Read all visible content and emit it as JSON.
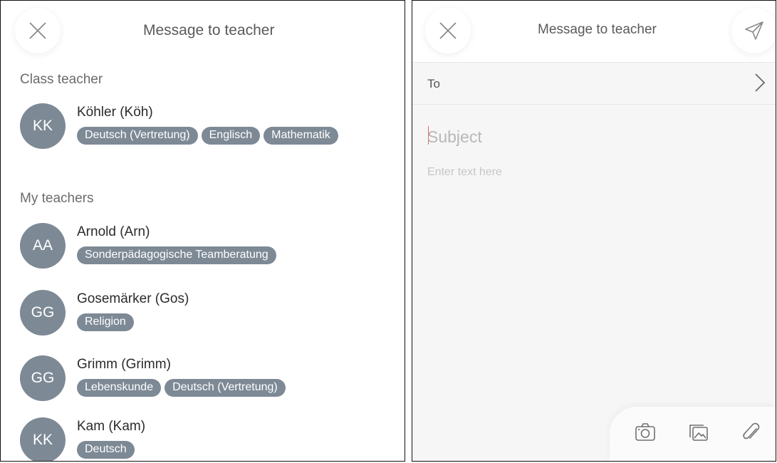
{
  "left": {
    "header": {
      "title": "Message to teacher",
      "close_icon": "close-icon"
    },
    "class_teacher": {
      "label": "Class teacher",
      "teachers": [
        {
          "initials": "KK",
          "name": "Köhler (Köh)",
          "subjects": [
            "Deutsch (Vertretung)",
            "Englisch",
            "Mathematik"
          ]
        }
      ]
    },
    "my_teachers": {
      "label": "My teachers",
      "teachers": [
        {
          "initials": "AA",
          "name": "Arnold (Arn)",
          "subjects": [
            "Sonderpädagogische Teamberatung"
          ]
        },
        {
          "initials": "GG",
          "name": "Gosemärker (Gos)",
          "subjects": [
            "Religion"
          ]
        },
        {
          "initials": "GG",
          "name": "Grimm (Grimm)",
          "subjects": [
            "Lebenskunde",
            "Deutsch (Vertretung)"
          ]
        },
        {
          "initials": "KK",
          "name": "Kam (Kam)",
          "subjects": [
            "Deutsch"
          ]
        }
      ]
    }
  },
  "right": {
    "header": {
      "title": "Message to teacher",
      "close_icon": "close-icon",
      "send_icon": "send-icon"
    },
    "to": {
      "label": "To",
      "icon": "chevron-right-icon"
    },
    "subject": {
      "placeholder": "Subject"
    },
    "body": {
      "placeholder": "Enter text here"
    },
    "attachments": [
      "camera-icon",
      "image-icon",
      "paperclip-icon"
    ]
  },
  "colors": {
    "avatar_bg": "#7d8995",
    "chip_bg": "#7d8995",
    "compose_bg": "#f6f6f6",
    "cursor": "#e56b6b"
  }
}
